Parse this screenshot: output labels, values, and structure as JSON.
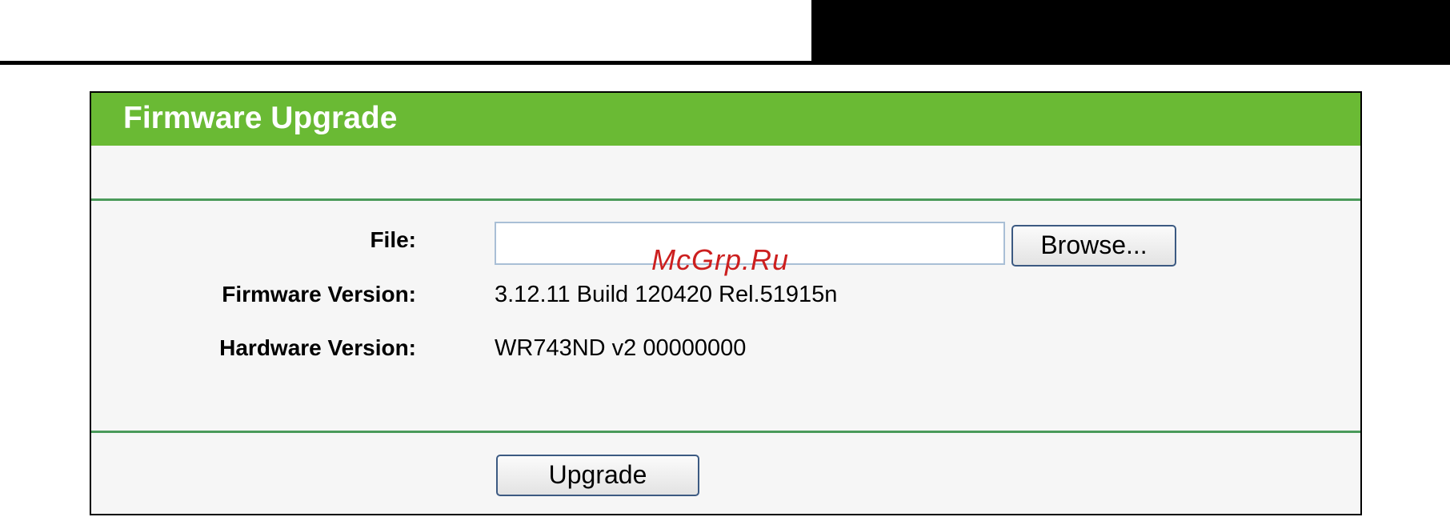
{
  "panel": {
    "title": "Firmware Upgrade",
    "header_color": "#6aba34",
    "divider_color": "#4a9a5a"
  },
  "form": {
    "file_label": "File:",
    "file_value": "",
    "browse_label": "Browse...",
    "firmware_label": "Firmware Version:",
    "firmware_value": "3.12.11 Build 120420 Rel.51915n",
    "hardware_label": "Hardware Version:",
    "hardware_value": "WR743ND v2 00000000",
    "upgrade_label": "Upgrade"
  },
  "watermark": {
    "text": "McGrp.Ru",
    "color": "#cc1f1f"
  }
}
